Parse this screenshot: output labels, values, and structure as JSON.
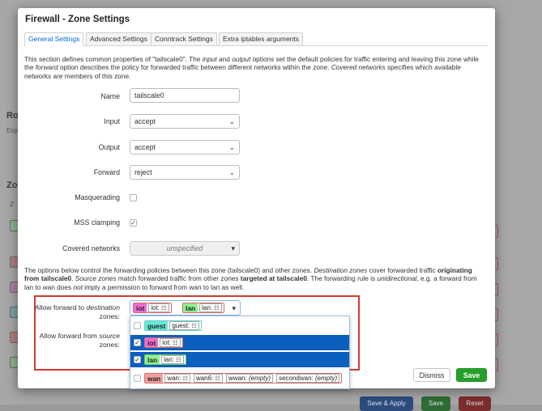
{
  "background": {
    "fragments": [
      "Ro",
      "Exp",
      "Zo",
      "Z"
    ],
    "bottom_buttons": [
      "Save & Apply",
      "Save",
      "Reset"
    ]
  },
  "modal": {
    "title": "Firewall - Zone Settings",
    "tabs": [
      "General Settings",
      "Advanced Settings",
      "Conntrack Settings",
      "Extra iptables arguments"
    ],
    "intro": {
      "p1": "This section defines common properties of \"tailscale0\". The ",
      "input_word": "input",
      "p2": " and ",
      "output_word": "output",
      "p3": " options set the default policies for traffic entering and leaving this zone while the ",
      "forward_word": "forward",
      "p4": " option describes the policy for forwarded traffic between different networks within the zone. ",
      "covered_word": "Covered networks",
      "p5": " specifies which available networks are members of this zone."
    },
    "fields": {
      "name_label": "Name",
      "name_value": "tailscale0",
      "input_label": "Input",
      "input_value": "accept",
      "output_label": "Output",
      "output_value": "accept",
      "forward_label": "Forward",
      "forward_value": "reject",
      "masquerading_label": "Masquerading",
      "mss_label": "MSS clamping",
      "covered_label": "Covered networks",
      "covered_value": "unspecified"
    },
    "forwarding_desc": {
      "p1": "The options below control the forwarding policies between this zone (tailscale0) and other zones. ",
      "dest_zones": "Destination zones",
      "p2": " cover forwarded traffic ",
      "originating": "originating from tailscale0",
      "p3": ". ",
      "src_zones": "Source zones",
      "p4": " match forwarded traffic from other zones ",
      "targeted": "targeted at tailscale0",
      "p5": ". The forwarding rule is ",
      "unidirectional": "unidirectional",
      "p6": ", e.g. a forward from lan to wan does ",
      "not_word": "not",
      "p7": " imply a permission to forward from wan to lan as well."
    },
    "forward_dest": {
      "label_prefix": "Allow forward to ",
      "label_em": "destination",
      "label_suffix": "zones:",
      "selected": [
        {
          "zone": "iot",
          "net": "iot:",
          "color": "#f06bd2"
        },
        {
          "zone": "lan",
          "net": "lan:",
          "color": "#90f090"
        }
      ]
    },
    "forward_src": {
      "label_prefix": "Allow forward from ",
      "label_em": "source",
      "label_suffix": "zones:"
    },
    "dropdown": {
      "items": [
        {
          "zone": "guest",
          "color": "#66e8d6",
          "checked": false,
          "selected": false,
          "nets": [
            "guest:"
          ]
        },
        {
          "zone": "iot",
          "color": "#f06bd2",
          "checked": true,
          "selected": true,
          "nets": [
            "iot:"
          ]
        },
        {
          "zone": "lan",
          "color": "#90f090",
          "checked": true,
          "selected": true,
          "nets": [
            "lan:"
          ]
        },
        {
          "zone": "wan",
          "color": "#f0a0a0",
          "checked": false,
          "selected": false,
          "nets": [
            "wan:",
            "wan6:",
            "wwan:",
            "secondwan:"
          ],
          "empty_label": "(empty)"
        }
      ]
    },
    "buttons": {
      "dismiss": "Dismiss",
      "save": "Save"
    }
  }
}
